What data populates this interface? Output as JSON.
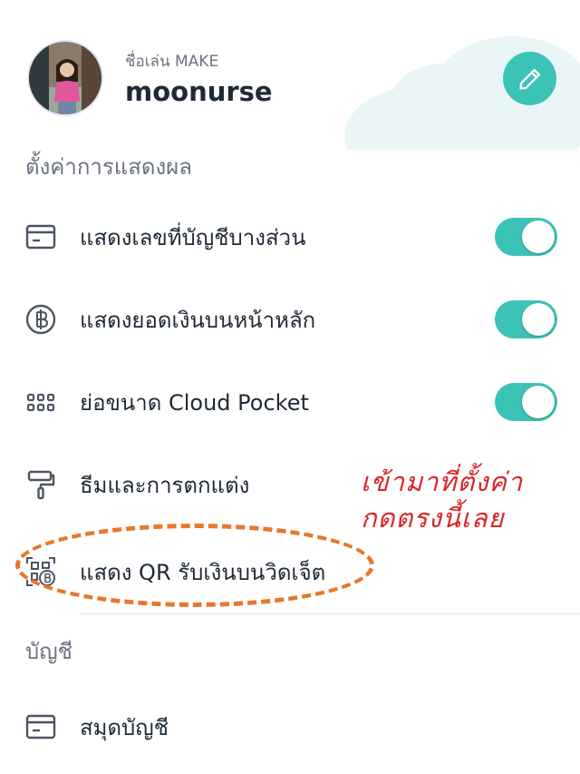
{
  "profile": {
    "nickname_label": "ชื่อเล่น MAKE",
    "username": "moonurse"
  },
  "sections": {
    "display_settings": "ตั้งค่าการแสดงผล",
    "account": "บัญชี"
  },
  "settings": {
    "account_number": {
      "label": "แสดงเลขที่บัญชีบางส่วน",
      "icon": "card-icon",
      "enabled": true
    },
    "balance": {
      "label": "แสดงยอดเงินบนหน้าหลัก",
      "icon": "baht-coin-icon",
      "enabled": true
    },
    "cloud_pocket": {
      "label": "ย่อขนาด Cloud Pocket",
      "icon": "grid-dots-icon",
      "enabled": true
    },
    "theme": {
      "label": "ธีมและการตกแต่ง",
      "icon": "paint-roller-icon"
    },
    "qr_receive": {
      "label": "แสดง QR รับเงินบนวิดเจ็ต",
      "icon": "qr-baht-icon"
    }
  },
  "account_items": {
    "passbook": {
      "label": "สมุดบัญชี",
      "icon": "card-icon"
    }
  },
  "annotation": {
    "line1": "เข้ามาที่ตั้งค่า",
    "line2": "กดตรงนี้เลย",
    "text_color": "#d9252a",
    "oval_color": "#e7772b"
  },
  "colors": {
    "accent": "#3cc3b8",
    "text": "#1f2937",
    "muted": "#6b7280"
  }
}
